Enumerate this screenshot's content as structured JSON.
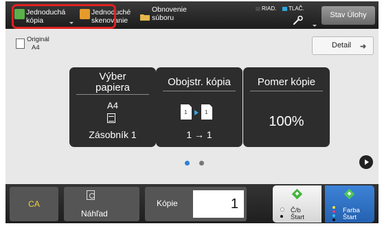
{
  "topbar": {
    "simple_copy": {
      "line1": "Jednoduchá",
      "line2": "kópia"
    },
    "simple_scan": {
      "line1": "Jednoduché",
      "line2": "skenovanie"
    },
    "file_retrieve": {
      "line1": "Obnovenie",
      "line2": "súboru"
    },
    "riad_label": "RIAD.",
    "tlac_label": "TLAČ.",
    "job_status_label": "Stav Úlohy"
  },
  "original": {
    "label": "Originál",
    "size": "A4"
  },
  "detail_label": "Detail",
  "tiles": {
    "paper": {
      "title_line1": "Výber",
      "title_line2": "papiera",
      "size": "A4",
      "tray": "Zásobník 1"
    },
    "duplex": {
      "title": "Obojstr. kópia",
      "mode": "1 → 1"
    },
    "ratio": {
      "title": "Pomer kópie",
      "value": "100%"
    }
  },
  "bottombar": {
    "ca_label": "CA",
    "preview_label": "Náhľad",
    "copies_label": "Kópie",
    "copies_value": "1",
    "bw_start": {
      "line1": "Č/b",
      "line2": "Štart"
    },
    "color_start": {
      "line1": "Farba",
      "line2": "Štart"
    }
  },
  "colors": {
    "accent_blue": "#2e70c8",
    "highlight_red": "#e02020",
    "ca_yellow": "#f3d23a",
    "tlac_indicator": "#2fa6e0"
  },
  "icons": [
    "copy-mode-icon",
    "scan-mode-icon",
    "folder-icon",
    "wrench-icon",
    "original-doc-icon",
    "detail-arrow-icon",
    "tray-icon",
    "duplex-icon",
    "next-page-icon",
    "preview-icon",
    "start-diamond-icon"
  ]
}
